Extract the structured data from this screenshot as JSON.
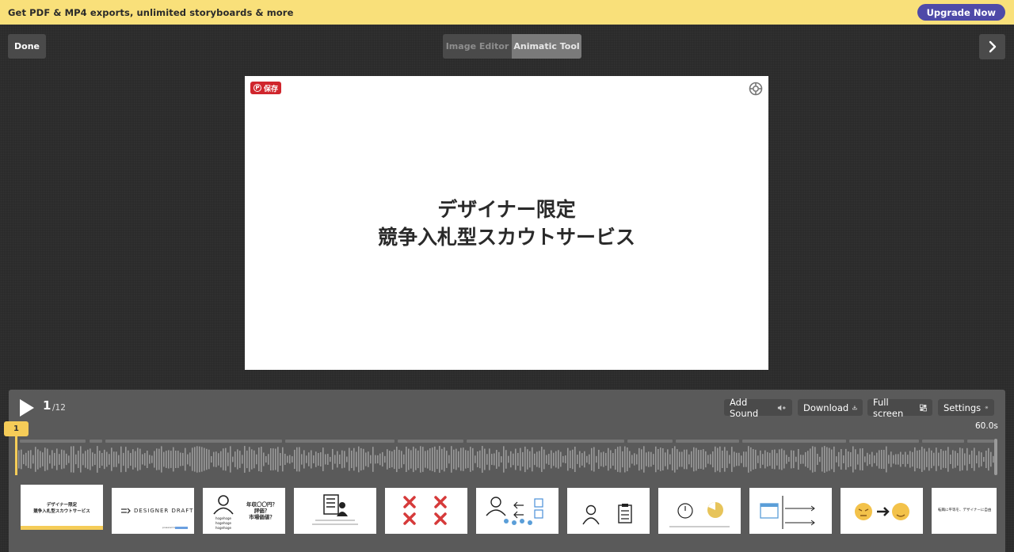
{
  "promo": {
    "text": "Get PDF & MP4 exports, unlimited storyboards & more",
    "upgrade_label": "Upgrade Now"
  },
  "toolbar": {
    "done_label": "Done",
    "image_editor_label": "Image Editor",
    "animatic_tool_label": "Animatic Tool"
  },
  "canvas": {
    "pin_label": "保存",
    "title_line1": "デザイナー限定",
    "title_line2": "競争入札型スカウトサービス"
  },
  "player": {
    "current_frame": "1",
    "total_frames": "/12",
    "add_sound_label": "Add Sound",
    "download_label": "Download",
    "fullscreen_label": "Full screen",
    "settings_label": "Settings",
    "duration": "60.0s",
    "playhead_label": "1"
  },
  "thumbnails": {
    "t1_line1": "デザイナー限定",
    "t1_line2": "競争入札型スカウトサービス",
    "t2_text": "DESIGNER DRAFT",
    "t2_footer": "powered by",
    "t3_q1": "年収〇〇円？",
    "t3_q2": "評価？",
    "t3_q3": "市場価値？",
    "t3_items": [
      "hogehoge",
      "hogehoge",
      "hogehoge"
    ],
    "t11_text": "転職に平等を、デザイナーに自由"
  },
  "colors": {
    "promo_bg": "#f9e07a",
    "upgrade_bg": "#4e4aa8",
    "accent": "#f5cc58",
    "pin_red": "#d0262d"
  }
}
